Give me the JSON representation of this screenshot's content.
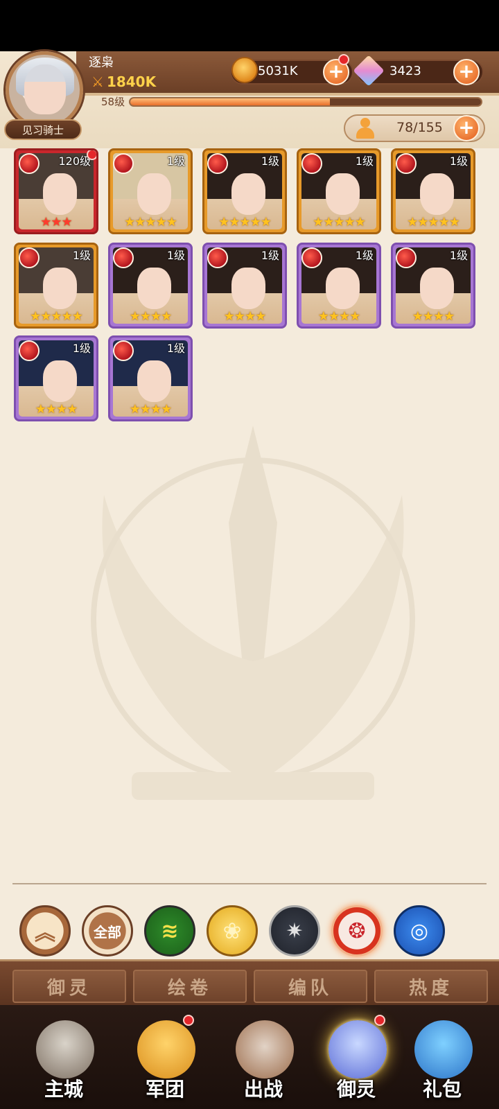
{
  "player": {
    "name": "逐枭",
    "power": "1840K",
    "rank": "见习骑士",
    "level_label": "58级",
    "xp_progress": 0.57
  },
  "resources": {
    "gold": "5031K",
    "gems": "3423",
    "capacity": "78/155"
  },
  "heroes": [
    {
      "level": "120级",
      "stars": 3,
      "star_color": "red",
      "frame": "red",
      "hair": "#4a3d35",
      "dot": true
    },
    {
      "level": "1级",
      "stars": 5,
      "star_color": "gold",
      "frame": "orange",
      "hair": "#d7c6a3",
      "dot": false
    },
    {
      "level": "1级",
      "stars": 5,
      "star_color": "gold",
      "frame": "orange",
      "hair": "#2b1f1a",
      "dot": false
    },
    {
      "level": "1级",
      "stars": 5,
      "star_color": "gold",
      "frame": "orange",
      "hair": "#2b1f1a",
      "dot": false
    },
    {
      "level": "1级",
      "stars": 5,
      "star_color": "gold",
      "frame": "orange",
      "hair": "#2b1f1a",
      "dot": false
    },
    {
      "level": "1级",
      "stars": 5,
      "star_color": "gold",
      "frame": "orange",
      "hair": "#4a3d35",
      "dot": false
    },
    {
      "level": "1级",
      "stars": 4,
      "star_color": "gold",
      "frame": "purple",
      "hair": "#2b1f1a",
      "dot": false
    },
    {
      "level": "1级",
      "stars": 4,
      "star_color": "gold",
      "frame": "purple",
      "hair": "#2b1f1a",
      "dot": false
    },
    {
      "level": "1级",
      "stars": 4,
      "star_color": "gold",
      "frame": "purple",
      "hair": "#2b1f1a",
      "dot": false
    },
    {
      "level": "1级",
      "stars": 4,
      "star_color": "gold",
      "frame": "purple",
      "hair": "#2b1f1a",
      "dot": false
    },
    {
      "level": "1级",
      "stars": 4,
      "star_color": "gold",
      "frame": "purple",
      "hair": "#1f2a4a",
      "dot": false
    },
    {
      "level": "1级",
      "stars": 4,
      "star_color": "gold",
      "frame": "purple",
      "hair": "#1f2a4a",
      "dot": false
    }
  ],
  "filters": {
    "collapse_icon": "chevron-double-up-icon",
    "all_label": "全部",
    "elements": [
      "wind-icon",
      "rose-icon",
      "dark-star-icon",
      "fire-icon",
      "water-icon"
    ]
  },
  "tabs": [
    {
      "label": "御灵",
      "active": true
    },
    {
      "label": "绘卷",
      "active": false
    },
    {
      "label": "编队",
      "active": false
    },
    {
      "label": "热度",
      "active": false
    }
  ],
  "nav": [
    {
      "label": "主城",
      "icon": "castle-icon",
      "active": false,
      "dot": false
    },
    {
      "label": "军团",
      "icon": "legion-icon",
      "active": false,
      "dot": true
    },
    {
      "label": "出战",
      "icon": "battle-icon",
      "active": false,
      "dot": false
    },
    {
      "label": "御灵",
      "icon": "crystal-icon",
      "active": true,
      "dot": true
    },
    {
      "label": "礼包",
      "icon": "gift-shop-icon",
      "active": false,
      "dot": false
    }
  ],
  "colors": {
    "accent_orange": "#e96f2b",
    "brown": "#6b3f26",
    "parchment": "#f4ebdc"
  }
}
